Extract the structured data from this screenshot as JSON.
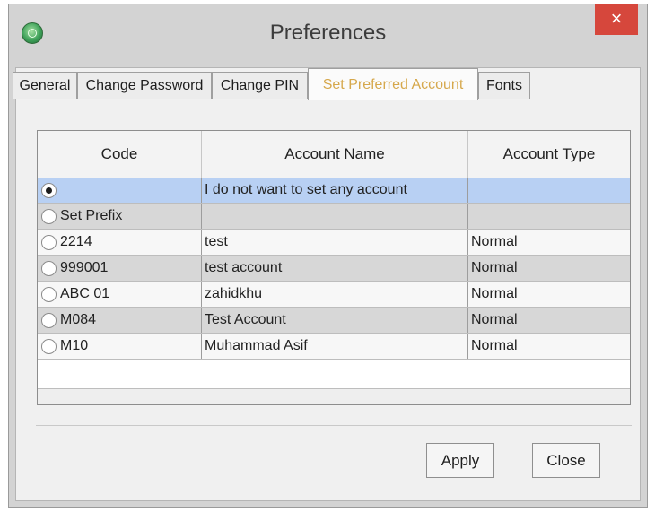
{
  "window": {
    "title": "Preferences",
    "close_glyph": "×",
    "app_icon": "globe-icon"
  },
  "tabs": [
    {
      "label": "General",
      "active": false
    },
    {
      "label": "Change Password",
      "active": false
    },
    {
      "label": "Change PIN",
      "active": false
    },
    {
      "label": "Set Preferred Account",
      "active": true
    },
    {
      "label": "Fonts",
      "active": false
    }
  ],
  "grid": {
    "headers": {
      "code": "Code",
      "name": "Account Name",
      "type": "Account Type"
    },
    "rows": [
      {
        "code": "",
        "name": "I do not want to set any account",
        "type": "",
        "selected": true
      },
      {
        "code": "Set Prefix",
        "name": "",
        "type": "",
        "selected": false
      },
      {
        "code": "2214",
        "name": "test",
        "type": "Normal",
        "selected": false
      },
      {
        "code": "999001",
        "name": "test account",
        "type": "Normal",
        "selected": false
      },
      {
        "code": "ABC 01",
        "name": "zahidkhu",
        "type": "Normal",
        "selected": false
      },
      {
        "code": "M084",
        "name": "Test Account",
        "type": "Normal",
        "selected": false
      },
      {
        "code": "M10",
        "name": "Muhammad Asif",
        "type": "Normal",
        "selected": false
      }
    ]
  },
  "buttons": {
    "apply": "Apply",
    "close": "Close"
  },
  "colors": {
    "selected_row": "#b8d0f3",
    "active_tab_text": "#d6a84c",
    "close_button": "#d6473c"
  }
}
